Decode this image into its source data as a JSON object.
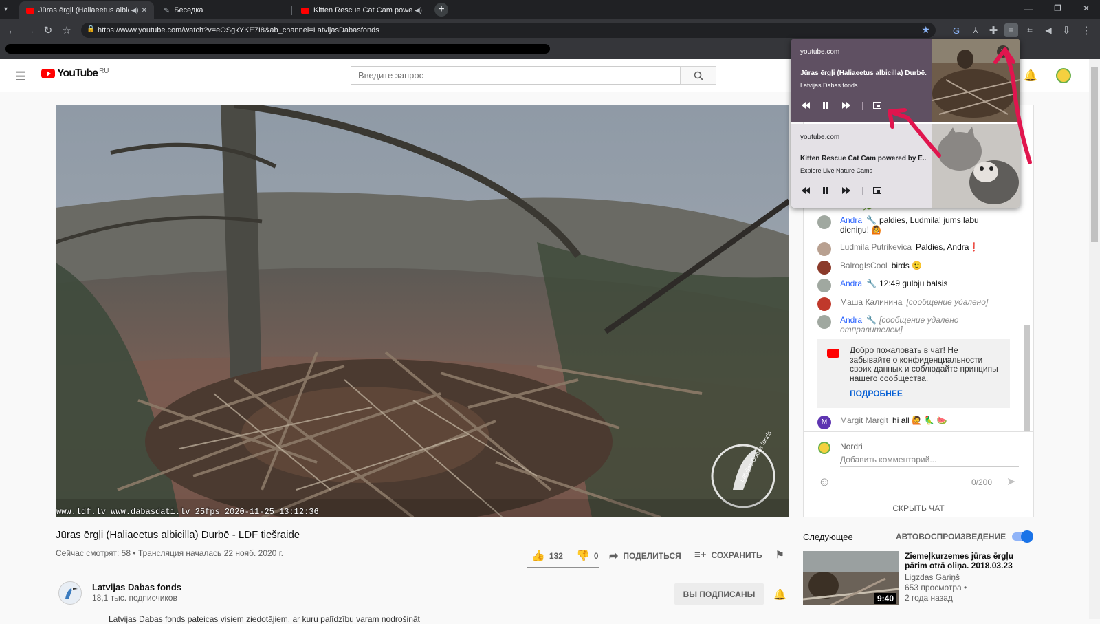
{
  "browser": {
    "tabs": [
      {
        "title": "Jūras ērgļi (Haliaeetus albicilla) D",
        "active": true,
        "icon": "youtube-icon"
      },
      {
        "title": "Беседка",
        "active": false,
        "icon": "quill-icon"
      },
      {
        "title": "Kitten Rescue Cat Cam powered",
        "active": false,
        "icon": "youtube-icon"
      }
    ],
    "url": "https://www.youtube.com/watch?v=eOSgkYKE7I8&ab_channel=LatvijasDabasfonds"
  },
  "youtube": {
    "logo_text": "YouTube",
    "region": "RU",
    "search_placeholder": "Введите запрос"
  },
  "video": {
    "osd": "www.ldf.lv www.dabasdati.lv 25fps 2020-11-25 13:12:36",
    "watermark": "Latvijas Dabas fonds",
    "title": "Jūras ērgļi (Haliaeetus albicilla) Durbē - LDF tiešraide",
    "meta": "Сейчас смотрят: 58 • Трансляция началась 22 нояб. 2020 г.",
    "likes": "132",
    "dislikes": "0",
    "share": "ПОДЕЛИТЬСЯ",
    "save": "СОХРАНИТЬ"
  },
  "channel": {
    "name": "Latvijas Dabas fonds",
    "subs": "18,1 тыс. подписчиков",
    "subscribe_label": "ВЫ ПОДПИСАНЫ",
    "description": "Latvijas Dabas fonds pateicas visiem ziedotājiem, ar kuru palīdzību varam nodrošināt"
  },
  "chat": {
    "partial_line": "Jums 🌿",
    "messages": [
      {
        "author": "Andra",
        "mod": true,
        "text": "paldies, Ludmila! jums labu dieniņu! 🙆",
        "avatar": "#a0a8a0"
      },
      {
        "author": "Ludmila Putrikevica",
        "mod": false,
        "text": "Paldies, Andra❗",
        "avatar": "#b8a090"
      },
      {
        "author": "BalrogIsCool",
        "mod": false,
        "text": "birds 🙂",
        "avatar": "#8b3a2a"
      },
      {
        "author": "Andra",
        "mod": true,
        "text": "12:49 gulbju balsis",
        "avatar": "#a0a8a0"
      },
      {
        "author": "Маша Калинина",
        "mod": false,
        "text": "[сообщение удалено]",
        "deleted": true,
        "avatar": "#c0392b"
      },
      {
        "author": "Andra",
        "mod": true,
        "text": "[сообщение удалено отправителем]",
        "deleted": true,
        "avatar": "#a0a8a0"
      }
    ],
    "welcome_text": "Добро пожаловать в чат! Не забывайте о конфиденциальности своих данных и соблюдайте принципы нашего сообщества.",
    "welcome_link": "ПОДРОБНЕЕ",
    "last_message": {
      "author": "Margit Margit",
      "initial": "M",
      "text": "hi all 🙋 🦜 🍉"
    },
    "user_name": "Nordri",
    "input_placeholder": "Добавить комментарий...",
    "char_count": "0/200",
    "hide_label": "СКРЫТЬ ЧАТ"
  },
  "upnext": {
    "label": "Следующее",
    "autoplay_label": "АВТОВОСПРОИЗВЕДЕНИЕ",
    "autoplay_on": true,
    "video_title": "Ziemeļkurzemes jūras ērgļu pārim otrā oliņa. 2018.03.23",
    "video_channel": "Ligzdas Gariņš",
    "video_views": "653 просмотра •",
    "video_age": "2 года назад",
    "video_duration": "9:40"
  },
  "media_controls": [
    {
      "source": "youtube.com",
      "title": "Jūras ērgļi (Haliaeetus albicilla) Durbē...",
      "artist": "Latvijas Dabas fonds",
      "bg": "#5f5062",
      "fg": "#ffffff"
    },
    {
      "source": "youtube.com",
      "title": "Kitten Rescue Cat Cam powered by E...",
      "artist": "Explore Live Nature Cams",
      "bg": "#e4e1e6",
      "fg": "#202124"
    }
  ],
  "annotation_color": "#e0154e"
}
